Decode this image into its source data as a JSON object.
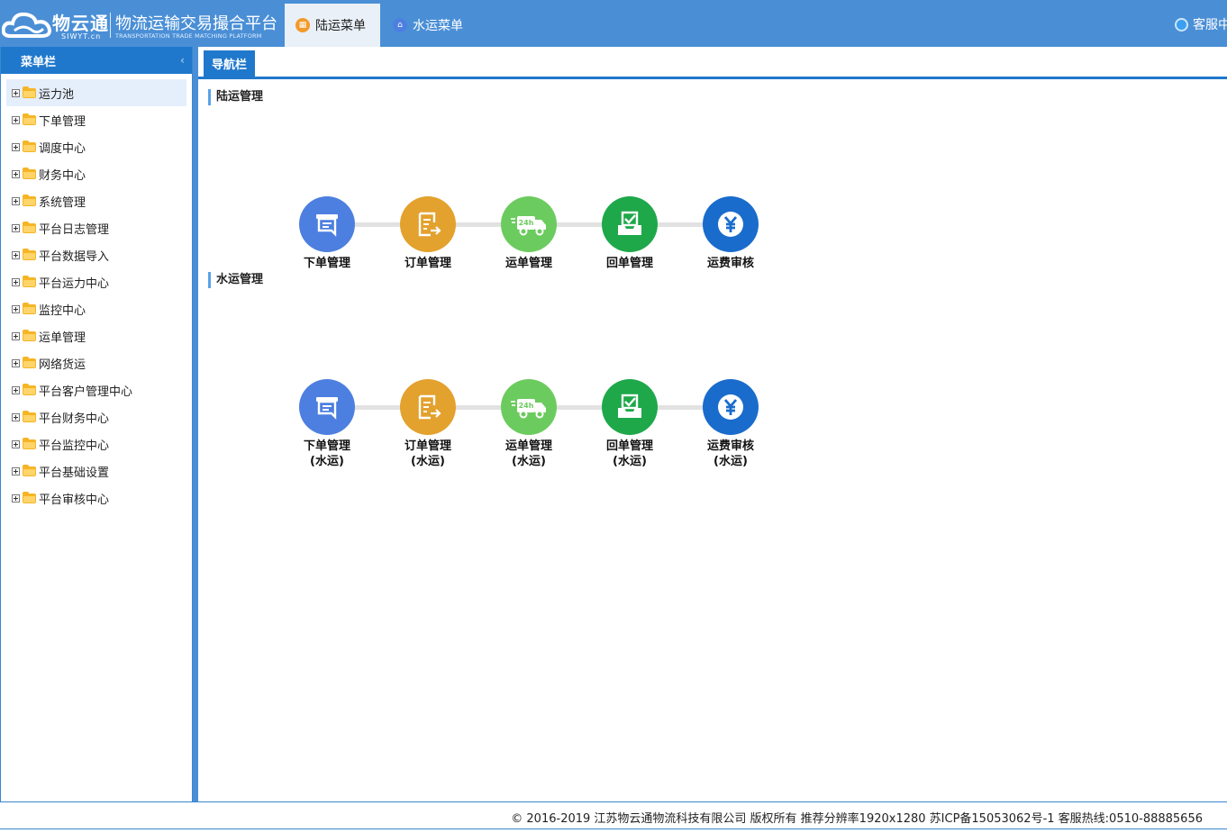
{
  "header": {
    "brand": "物云通",
    "domain": "SIWYT.cn",
    "platform_title": "物流运输交易撮合平台",
    "platform_subtitle": "TRANSPORTATION TRADE MATCHING PLATFORM",
    "tabs": [
      {
        "label": "陆运菜单",
        "icon": "land-menu-icon",
        "active": true
      },
      {
        "label": "水运菜单",
        "icon": "water-menu-icon",
        "active": false
      }
    ],
    "service_label": "客服中心"
  },
  "sidebar": {
    "title": "菜单栏",
    "items": [
      {
        "label": "运力池"
      },
      {
        "label": "下单管理"
      },
      {
        "label": "调度中心"
      },
      {
        "label": "财务中心"
      },
      {
        "label": "系统管理"
      },
      {
        "label": "平台日志管理"
      },
      {
        "label": "平台数据导入"
      },
      {
        "label": "平台运力中心"
      },
      {
        "label": "监控中心"
      },
      {
        "label": "运单管理"
      },
      {
        "label": "网络货运"
      },
      {
        "label": "平台客户管理中心"
      },
      {
        "label": "平台财务中心"
      },
      {
        "label": "平台监控中心"
      },
      {
        "label": "平台基础设置"
      },
      {
        "label": "平台审核中心"
      }
    ]
  },
  "main": {
    "nav_tab": "导航栏",
    "land": {
      "title": "陆运管理",
      "steps": [
        {
          "label": "下单管理",
          "icon": "order-placement-icon",
          "color": "#4d7fe0"
        },
        {
          "label": "订单管理",
          "icon": "order-management-icon",
          "color": "#e3a12d"
        },
        {
          "label": "运单管理",
          "icon": "delivery-truck-icon",
          "color": "#6ccb5f"
        },
        {
          "label": "回单管理",
          "icon": "receipt-check-icon",
          "color": "#1ea84a"
        },
        {
          "label": "运费审核",
          "icon": "yuan-audit-icon",
          "color": "#1a6ccc"
        }
      ]
    },
    "water": {
      "title": "水运管理",
      "suffix": "(水运)",
      "steps": [
        {
          "label": "下单管理",
          "icon": "order-placement-icon",
          "color": "#4d7fe0"
        },
        {
          "label": "订单管理",
          "icon": "order-management-icon",
          "color": "#e3a12d"
        },
        {
          "label": "运单管理",
          "icon": "delivery-truck-icon",
          "color": "#6ccb5f"
        },
        {
          "label": "回单管理",
          "icon": "receipt-check-icon",
          "color": "#1ea84a"
        },
        {
          "label": "运费审核",
          "icon": "yuan-audit-icon",
          "color": "#1a6ccc"
        }
      ]
    },
    "truck_badge": "24h"
  },
  "footer": {
    "text": "© 2016-2019 江苏物云通物流科技有限公司 版权所有 推荐分辨率1920x1280  苏ICP备15053062号-1  客服热线:0510-88885656"
  }
}
